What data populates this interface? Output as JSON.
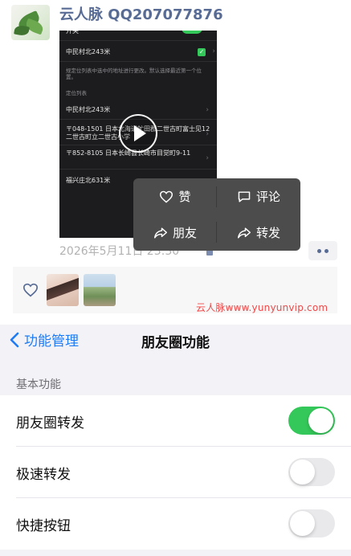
{
  "post": {
    "author": "云人脉 QQ207077876",
    "timestamp": "2026年5月11日 23:30",
    "video": {
      "toggle_row_label": "开关",
      "current_location": "中民村北243米",
      "note": "规定位列表中选中的地址进行更改。默认选择最近第一个位置。",
      "list_header": "定位列表",
      "locations": [
        "中民村北243米",
        "〒048-1501 日本北海道虻田郡二世古町富士见12 二世古町立二世古小学",
        "〒852-8105 日本长崎县长崎市目觉町9-11",
        "福兴庄北631米"
      ]
    },
    "menu": {
      "like_label": "赞",
      "comment_label": "评论",
      "moments_share_label": "朋友",
      "forward_label": "转发"
    },
    "watermark": "云人脉www.yunyunvip.com"
  },
  "settings": {
    "back_label": "功能管理",
    "title": "朋友圈功能",
    "section_header": "基本功能",
    "rows": [
      {
        "label": "朋友圈转发",
        "on": true
      },
      {
        "label": "极速转发",
        "on": false
      },
      {
        "label": "快捷按钮",
        "on": false
      }
    ]
  },
  "colors": {
    "name_blue": "#576b95",
    "ios_blue": "#1f7cf5",
    "toggle_green": "#34c759",
    "watermark_red": "#f04848"
  }
}
